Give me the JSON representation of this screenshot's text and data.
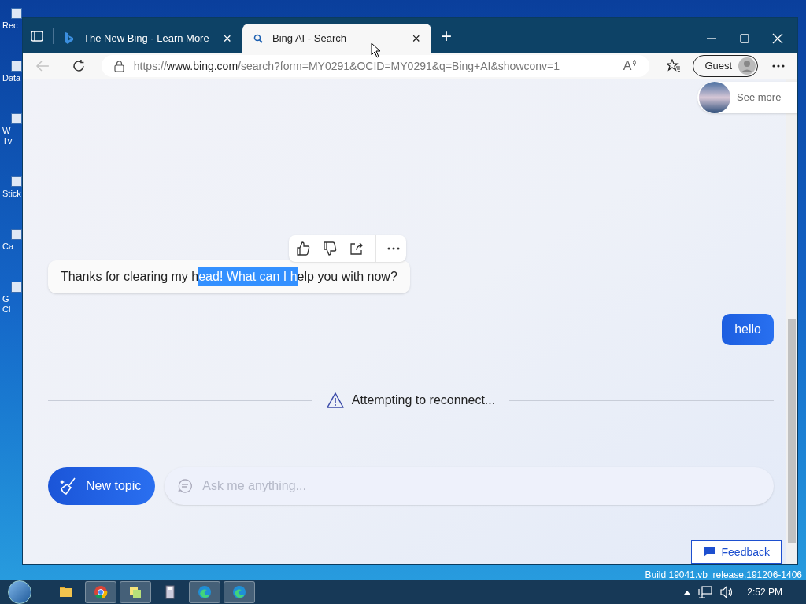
{
  "desktop_icons": [
    {
      "lines": [
        "Rec"
      ]
    },
    {
      "lines": [
        "Data"
      ]
    },
    {
      "lines": [
        "W",
        "Tv"
      ]
    },
    {
      "lines": [
        "Stick"
      ]
    },
    {
      "lines": [
        "Ca"
      ]
    },
    {
      "lines": [
        "G",
        "Cl"
      ]
    }
  ],
  "tabs": [
    {
      "title": "The New Bing - Learn More",
      "close": "×",
      "selected": false,
      "kind": "bing"
    },
    {
      "title": "Bing AI - Search",
      "close": "×",
      "selected": true,
      "kind": "search"
    }
  ],
  "new_tab": "+",
  "address_bar": {
    "url_prefix": "https://",
    "url_host": "www.bing.com",
    "url_rest": "/search?form=MY0291&OCID=MY0291&q=Bing+AI&showconv=1",
    "read_aloud": "A"
  },
  "profile": {
    "label": "Guest"
  },
  "see_more": {
    "label": "See more"
  },
  "bot_message": {
    "text_before": "Thanks for clearing my h",
    "selected_text": "ead! What can I h",
    "text_after": "elp you with now?"
  },
  "user_message": {
    "text": "hello"
  },
  "status": {
    "text": "Attempting to reconnect..."
  },
  "new_topic": {
    "label": "New topic"
  },
  "input": {
    "placeholder": "Ask me anything..."
  },
  "feedback": {
    "label": "Feedback"
  },
  "build_text": "Build 19041.vb_release.191206-1406",
  "taskbar": {
    "apps": [
      {
        "kind": "folder",
        "active": false
      },
      {
        "kind": "chrome",
        "active": true
      },
      {
        "kind": "notes",
        "active": true
      },
      {
        "kind": "calculator",
        "active": false
      },
      {
        "kind": "edge",
        "active": true
      },
      {
        "kind": "edge",
        "active": true
      }
    ],
    "time": "2:52 PM"
  }
}
